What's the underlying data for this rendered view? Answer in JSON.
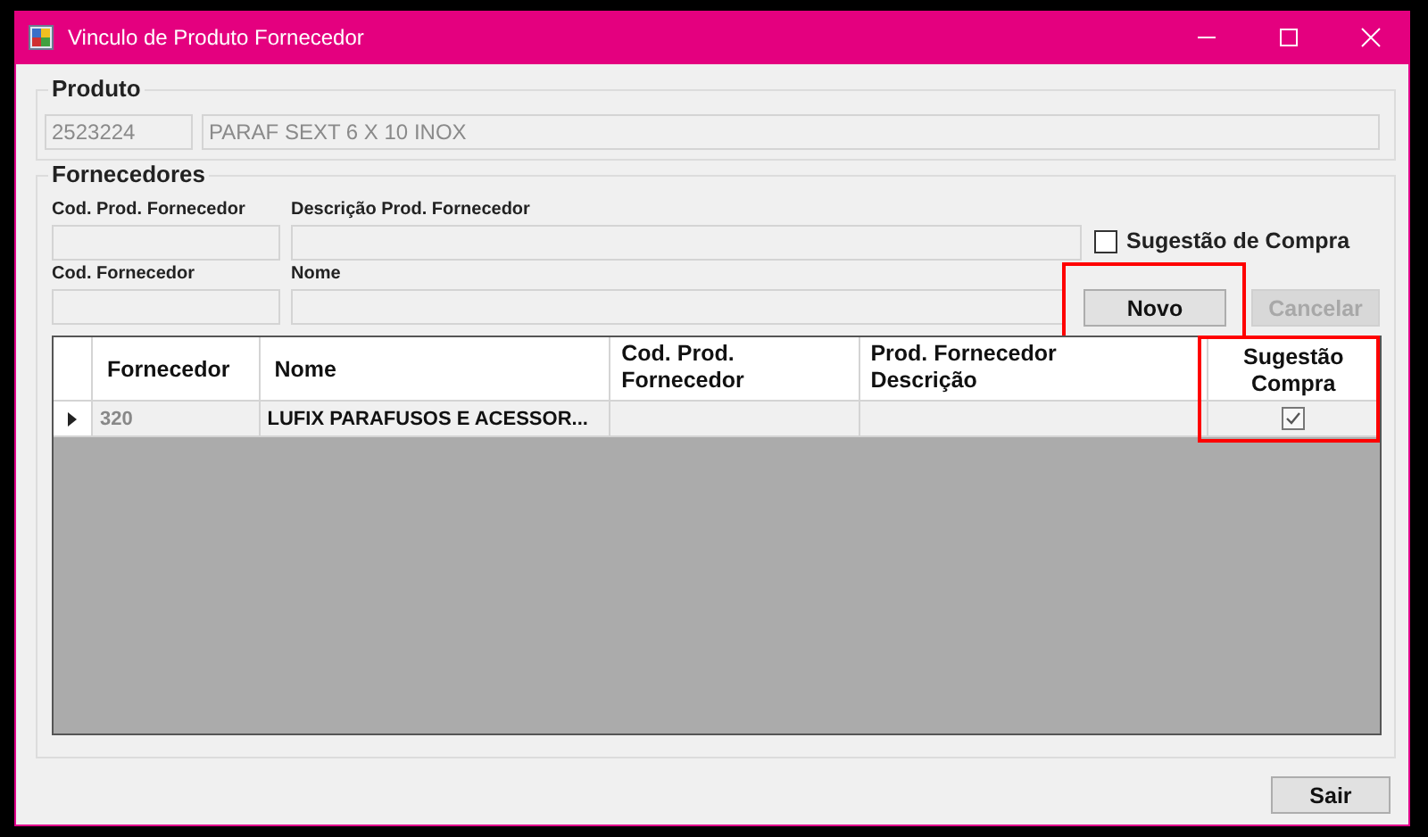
{
  "window": {
    "title": "Vinculo de Produto Fornecedor"
  },
  "produto": {
    "title": "Produto",
    "code": "2523224",
    "description": "PARAF SEXT 6 X 10 INOX"
  },
  "fornecedores": {
    "title": "Fornecedores",
    "fields": [
      {
        "label": "Cod. Prod. Fornecedor"
      },
      {
        "label": "Descrição Prod. Fornecedor"
      },
      {
        "label": "Cod. Fornecedor"
      },
      {
        "label": "Nome"
      }
    ],
    "suggestion_checkbox": {
      "label": "Sugestão de Compra",
      "checked": false
    },
    "buttons": [
      {
        "label": "Novo",
        "disabled": false,
        "highlighted": true
      },
      {
        "label": "Cancelar",
        "disabled": true,
        "highlighted": false
      }
    ]
  },
  "table": {
    "columns": [
      {
        "label": "Fornecedor",
        "highlighted": false
      },
      {
        "label": "Nome",
        "highlighted": false
      },
      {
        "label": "Cod. Prod. Fornecedor",
        "highlighted": false
      },
      {
        "label": "Prod. Fornecedor Descrição",
        "highlighted": false
      },
      {
        "label": "Sugestão Compra",
        "highlighted": true
      }
    ],
    "rows": [
      {
        "selected": true,
        "fornecedor": "320",
        "nome": "LUFIX PARAFUSOS E ACESSOR...",
        "cod_prod": "",
        "descricao": "",
        "sugestao": true
      }
    ]
  },
  "footer_button": "Sair"
}
